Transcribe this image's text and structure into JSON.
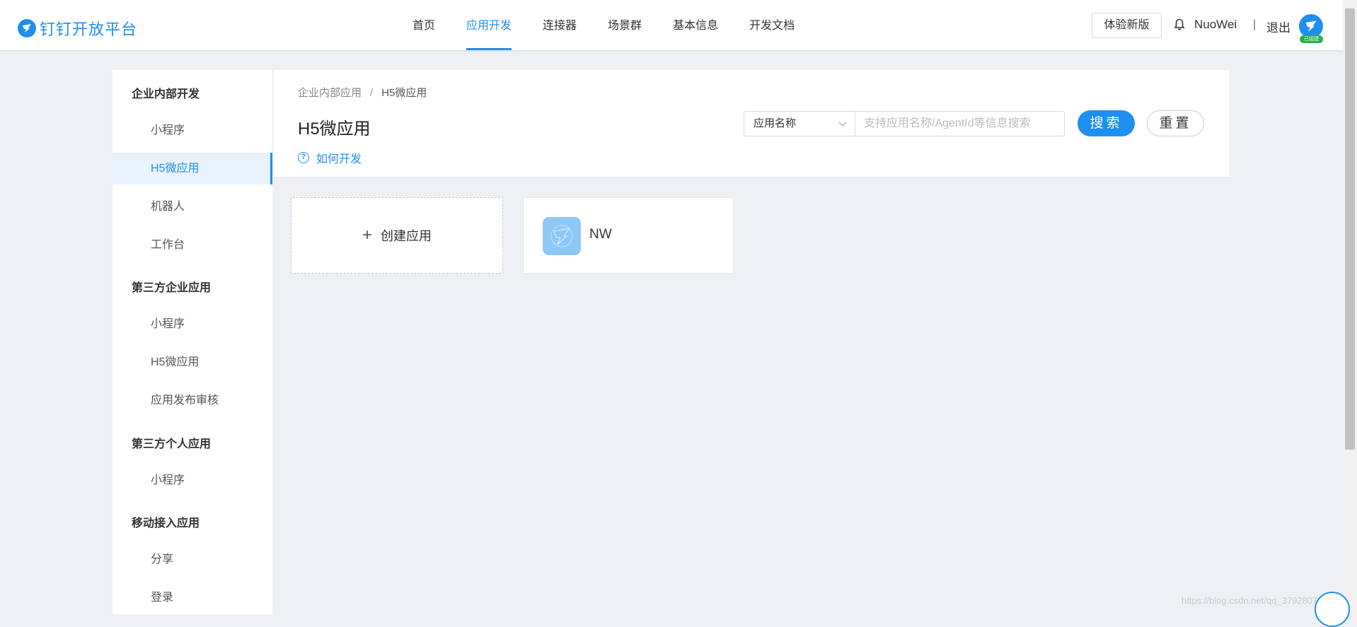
{
  "brand": {
    "name": "钉钉开放平台"
  },
  "nav": {
    "items": [
      "首页",
      "应用开发",
      "连接器",
      "场景群",
      "基本信息",
      "开发文档"
    ],
    "active_index": 1
  },
  "header": {
    "try_new_label": "体验新版",
    "username": "NuoWei",
    "separator": "|",
    "logout_label": "退出",
    "verified_badge": "已認證"
  },
  "sidebar": {
    "groups": [
      {
        "title": "企业内部开发",
        "items": [
          "小程序",
          "H5微应用",
          "机器人",
          "工作台"
        ]
      },
      {
        "title": "第三方企业应用",
        "items": [
          "小程序",
          "H5微应用",
          "应用发布审核"
        ]
      },
      {
        "title": "第三方个人应用",
        "items": [
          "小程序"
        ]
      },
      {
        "title": "移动接入应用",
        "items": [
          "分享",
          "登录"
        ]
      }
    ],
    "active_item": "H5微应用"
  },
  "breadcrumb": {
    "parent": "企业内部应用",
    "separator": "/",
    "current": "H5微应用"
  },
  "page": {
    "title": "H5微应用",
    "howto_label": "如何开发"
  },
  "search": {
    "select_value": "应用名称",
    "placeholder": "支持应用名称/AgentId等信息搜索",
    "value": "",
    "search_label": "搜索",
    "reset_label": "重置"
  },
  "cards": {
    "create_label": "创建应用",
    "apps": [
      {
        "name": "NW",
        "icon": "dingtalk-app-icon"
      }
    ]
  },
  "watermark": "https://blog.csdn.net/qq_37928074",
  "colors": {
    "accent": "#1f8ef1",
    "background": "#eef0f4",
    "active_bg": "#e8f3fe",
    "verified": "#27b04b"
  }
}
